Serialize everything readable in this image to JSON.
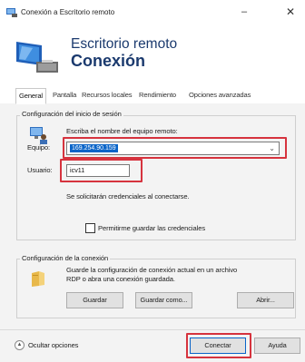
{
  "window": {
    "title": "Conexión a Escritorio remoto",
    "minimize_glyph": "–",
    "close_glyph": "✕",
    "icon": "remote-desktop-icon"
  },
  "header": {
    "line1": "Escritorio remoto",
    "line2": "Conexión",
    "logo": "remote-desktop-logo"
  },
  "tabs": [
    {
      "label": "General",
      "active": true
    },
    {
      "label": "Pantalla",
      "active": false
    },
    {
      "label": "Recursos locales",
      "active": false
    },
    {
      "label": "Rendimiento",
      "active": false
    },
    {
      "label": "Opciones avanzadas",
      "active": false
    }
  ],
  "login": {
    "group_title": "Configuración del inicio de sesión",
    "instruction": "Escriba el nombre del equipo remoto:",
    "computer_label": "Equipo:",
    "computer_value": "169.254.90.159",
    "user_label": "Usuario:",
    "user_value": "icv11",
    "credentials_note": "Se solicitarán credenciales al conectarse.",
    "save_credentials_label": "Permitirme guardar las credenciales",
    "save_credentials_checked": false,
    "icon": "computer-user-icon"
  },
  "connection": {
    "group_title": "Configuración de la conexión",
    "description_line1": "Guarde la configuración de conexión actual en un archivo",
    "description_line2": "RDP o abra una conexión guardada.",
    "save_label": "Guardar",
    "save_as_label": "Guardar como...",
    "open_label": "Abrir...",
    "icon": "folder-icon"
  },
  "footer": {
    "hide_options_label": "Ocultar opciones",
    "connect_label": "Conectar",
    "help_label": "Ayuda"
  },
  "colors": {
    "title_blue": "#1b3a6e",
    "highlight": "#d6333e",
    "selection": "#0a64c8"
  }
}
